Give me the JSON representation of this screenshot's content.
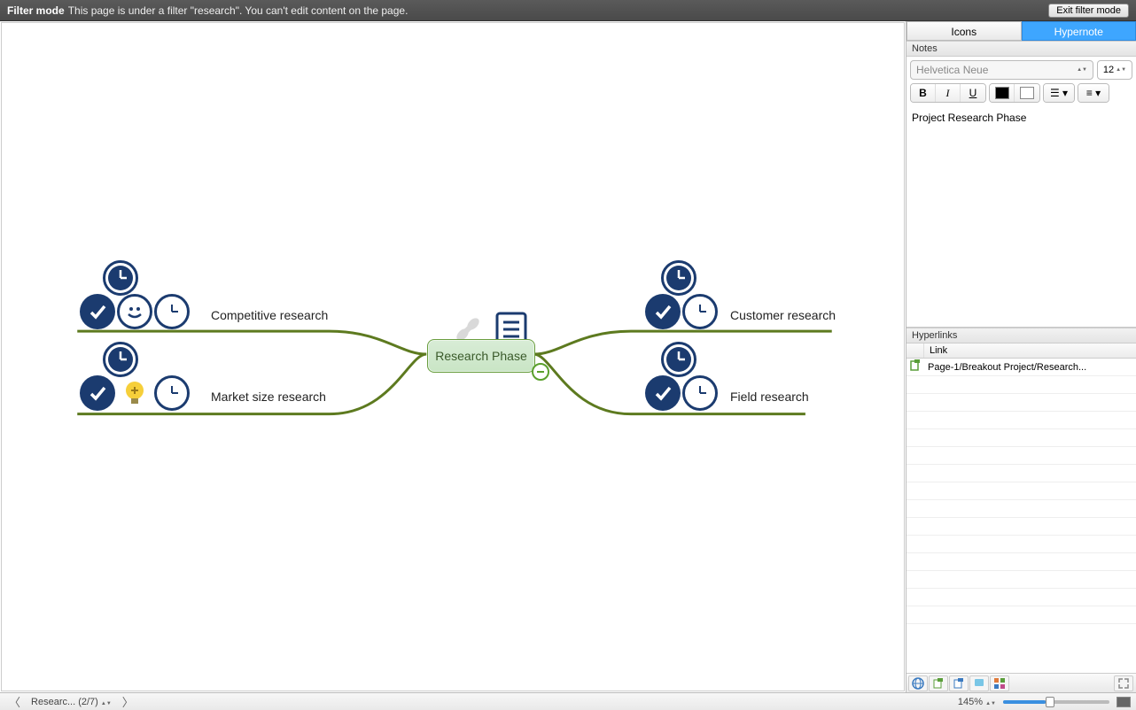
{
  "filter_bar": {
    "mode_label": "Filter mode",
    "message": "This page is under a filter \"research\". You can't edit content on the page.",
    "exit_button": "Exit filter mode"
  },
  "mindmap": {
    "central": "Research Phase",
    "branches": [
      {
        "id": "competitive",
        "label": "Competitive research",
        "side": "left",
        "icons": [
          "clock-filled",
          "check",
          "smile",
          "clock-outline"
        ]
      },
      {
        "id": "market",
        "label": "Market size research",
        "side": "left",
        "icons": [
          "clock-filled",
          "check",
          "bulb",
          "clock-outline"
        ]
      },
      {
        "id": "customer",
        "label": "Customer research",
        "side": "right",
        "icons": [
          "clock-filled",
          "check",
          "clock-outline"
        ]
      },
      {
        "id": "field",
        "label": "Field research",
        "side": "right",
        "icons": [
          "clock-filled",
          "check",
          "clock-outline"
        ]
      }
    ],
    "central_icons": [
      "link",
      "document"
    ],
    "collapse_indicator": "minus"
  },
  "sidebar": {
    "tabs": [
      {
        "label": "Icons",
        "active": false
      },
      {
        "label": "Hypernote",
        "active": true
      }
    ],
    "notes_section_title": "Notes",
    "font_name": "Helvetica Neue",
    "font_size": "12",
    "format_buttons": {
      "bold": "B",
      "italic": "I",
      "underline": "U"
    },
    "note_text": "Project Research Phase",
    "hyperlinks_section_title": "Hyperlinks",
    "hyperlinks_header": "Link",
    "hyperlinks": [
      {
        "icon": "page-link",
        "text": "Page-1/Breakout Project/Research..."
      }
    ],
    "footer_tools": [
      "globe",
      "page-link-green",
      "page-link-blue",
      "bookmark",
      "app-link"
    ]
  },
  "statusbar": {
    "page_label": "Researc...",
    "page_counter": "(2/7)",
    "zoom": "145%"
  },
  "colors": {
    "navy": "#1b3b6f",
    "branch": "#5d7a1f"
  }
}
